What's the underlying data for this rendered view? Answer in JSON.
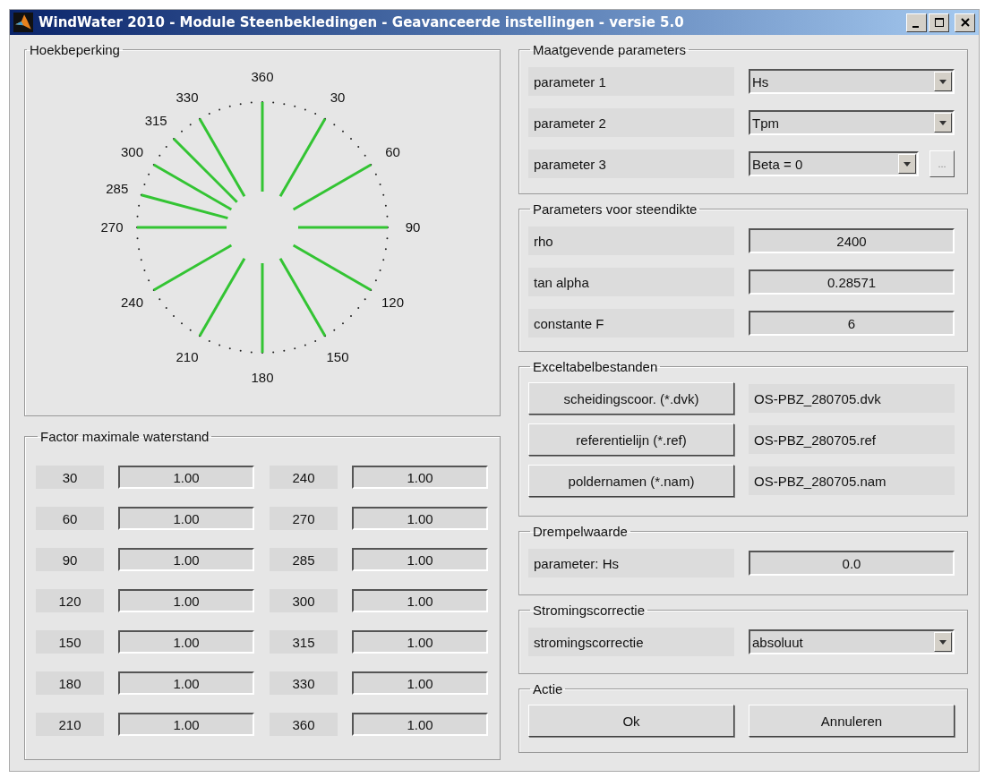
{
  "window": {
    "title": "WindWater 2010 - Module Steenbekledingen - Geavanceerde instellingen - versie 5.0"
  },
  "hoekbeperking": {
    "title": "Hoekbeperking",
    "labels": [
      "360",
      "30",
      "60",
      "90",
      "120",
      "150",
      "180",
      "210",
      "240",
      "270",
      "285",
      "300",
      "315",
      "330"
    ]
  },
  "factor": {
    "title": "Factor maximale waterstand",
    "rows": [
      {
        "label": "30",
        "value": "1.00"
      },
      {
        "label": "60",
        "value": "1.00"
      },
      {
        "label": "90",
        "value": "1.00"
      },
      {
        "label": "120",
        "value": "1.00"
      },
      {
        "label": "150",
        "value": "1.00"
      },
      {
        "label": "180",
        "value": "1.00"
      },
      {
        "label": "210",
        "value": "1.00"
      },
      {
        "label": "240",
        "value": "1.00"
      },
      {
        "label": "270",
        "value": "1.00"
      },
      {
        "label": "285",
        "value": "1.00"
      },
      {
        "label": "300",
        "value": "1.00"
      },
      {
        "label": "315",
        "value": "1.00"
      },
      {
        "label": "330",
        "value": "1.00"
      },
      {
        "label": "360",
        "value": "1.00"
      }
    ]
  },
  "maatgevend": {
    "title": "Maatgevende parameters",
    "rows": [
      {
        "label": "parameter 1",
        "value": "Hs"
      },
      {
        "label": "parameter 2",
        "value": "Tpm"
      },
      {
        "label": "parameter 3",
        "value": "Beta = 0",
        "extra_button": "..."
      }
    ]
  },
  "steendikte": {
    "title": "Parameters voor steendikte",
    "rows": [
      {
        "label": "rho",
        "value": "2400"
      },
      {
        "label": "tan alpha",
        "value": "0.28571"
      },
      {
        "label": "constante F",
        "value": "6"
      }
    ]
  },
  "excel": {
    "title": "Exceltabelbestanden",
    "rows": [
      {
        "button": "scheidingscoor. (*.dvk)",
        "file": "OS-PBZ_280705.dvk"
      },
      {
        "button": "referentielijn (*.ref)",
        "file": "OS-PBZ_280705.ref"
      },
      {
        "button": "poldernamen (*.nam)",
        "file": "OS-PBZ_280705.nam"
      }
    ]
  },
  "drempel": {
    "title": "Drempelwaarde",
    "label": "parameter: Hs",
    "value": "0.0"
  },
  "stroming": {
    "title": "Stromingscorrectie",
    "label": "stromingscorrectie",
    "value": "absoluut"
  },
  "actie": {
    "title": "Actie",
    "buttons": [
      "Ok",
      "Annuleren"
    ]
  }
}
